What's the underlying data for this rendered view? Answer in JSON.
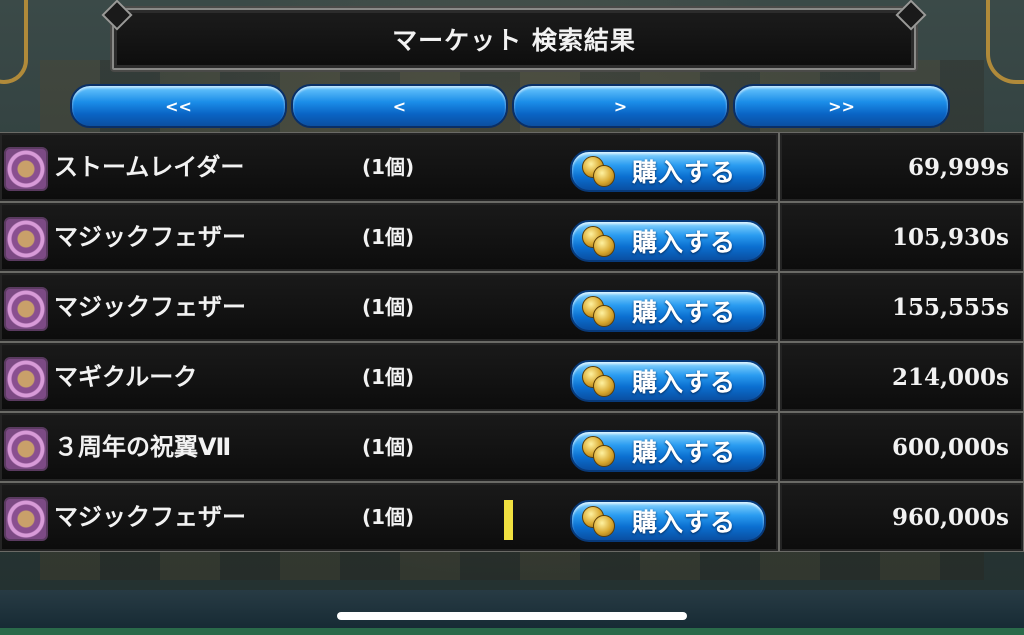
{
  "title": "マーケット 検索結果",
  "nav": {
    "first": "<<",
    "prev": "<",
    "next": ">",
    "last": ">>"
  },
  "buy_label": "購入する",
  "items": [
    {
      "name": "ストームレイダー",
      "qty": "(1個)",
      "price": "69,999s"
    },
    {
      "name": "マジックフェザー",
      "qty": "(1個)",
      "price": "105,930s"
    },
    {
      "name": "マジックフェザー",
      "qty": "(1個)",
      "price": "155,555s"
    },
    {
      "name": "マギクルーク",
      "qty": "(1個)",
      "price": "214,000s"
    },
    {
      "name": "３周年の祝翼Ⅶ",
      "qty": "(1個)",
      "price": "600,000s"
    },
    {
      "name": "マジックフェザー",
      "qty": "(1個)",
      "price": "960,000s"
    }
  ],
  "colors": {
    "button_blue": "#1b8de8",
    "panel_dark": "#111111",
    "text": "#f2f2f2"
  }
}
